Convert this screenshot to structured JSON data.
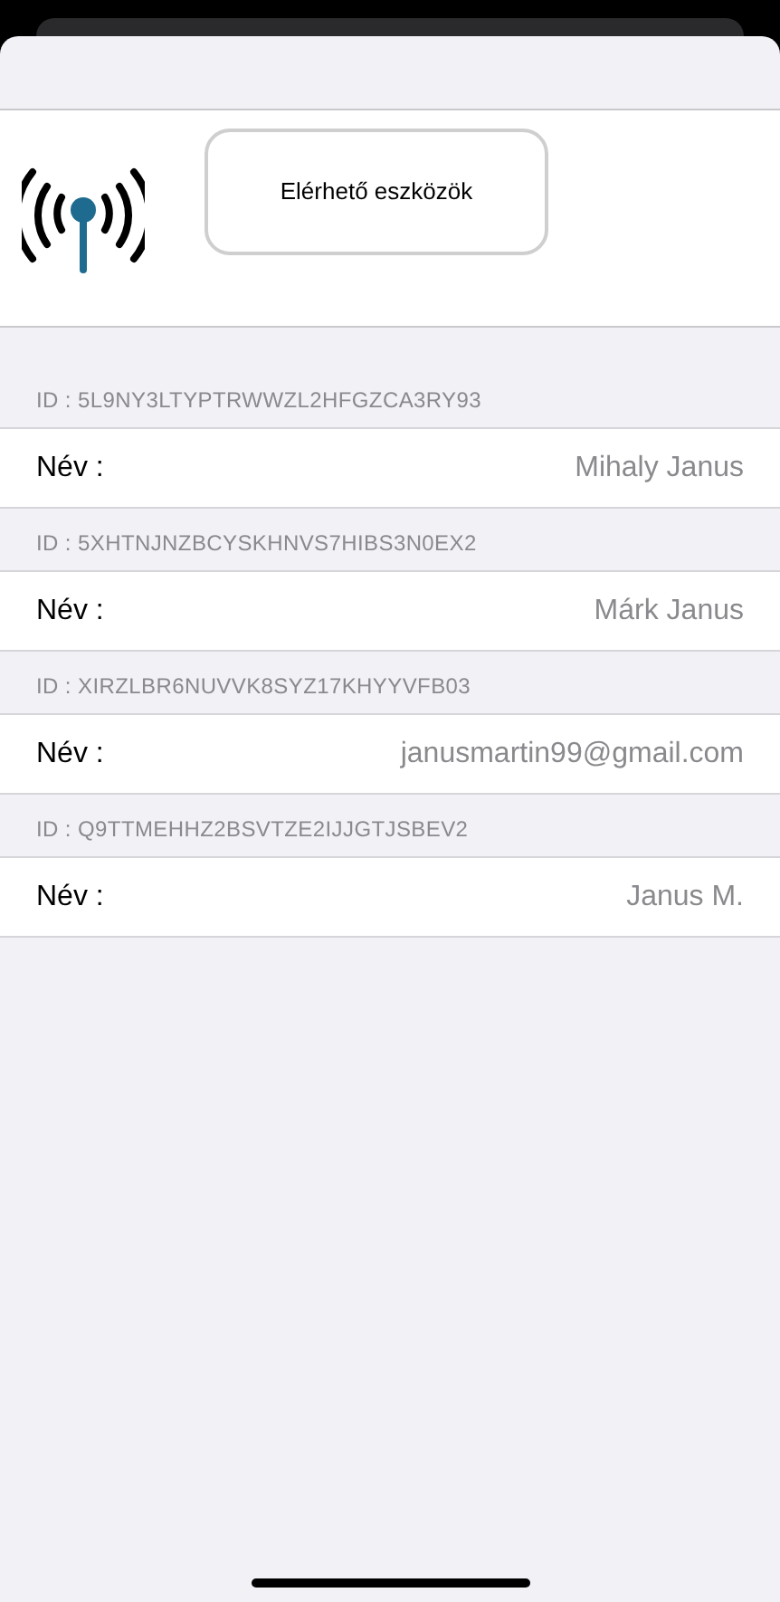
{
  "header": {
    "button": "Elérhető eszközök"
  },
  "devices": [
    {
      "id": "ID : 5L9NY3LTYPTRWWZL2HFGZCA3RY93",
      "label": "Név :",
      "value": "Mihaly Janus"
    },
    {
      "id": "ID : 5XHTNJNZBCYSKHNVS7HIBS3N0EX2",
      "label": "Név :",
      "value": "Márk Janus"
    },
    {
      "id": "ID : XIRZLBR6NUVVK8SYZ17KHYYVFB03",
      "label": "Név :",
      "value": "janusmartin99@gmail.com"
    },
    {
      "id": "ID : Q9TTMEHHZ2BSVTZE2IJJGTJSBEV2",
      "label": "Név :",
      "value": "Janus M."
    }
  ]
}
